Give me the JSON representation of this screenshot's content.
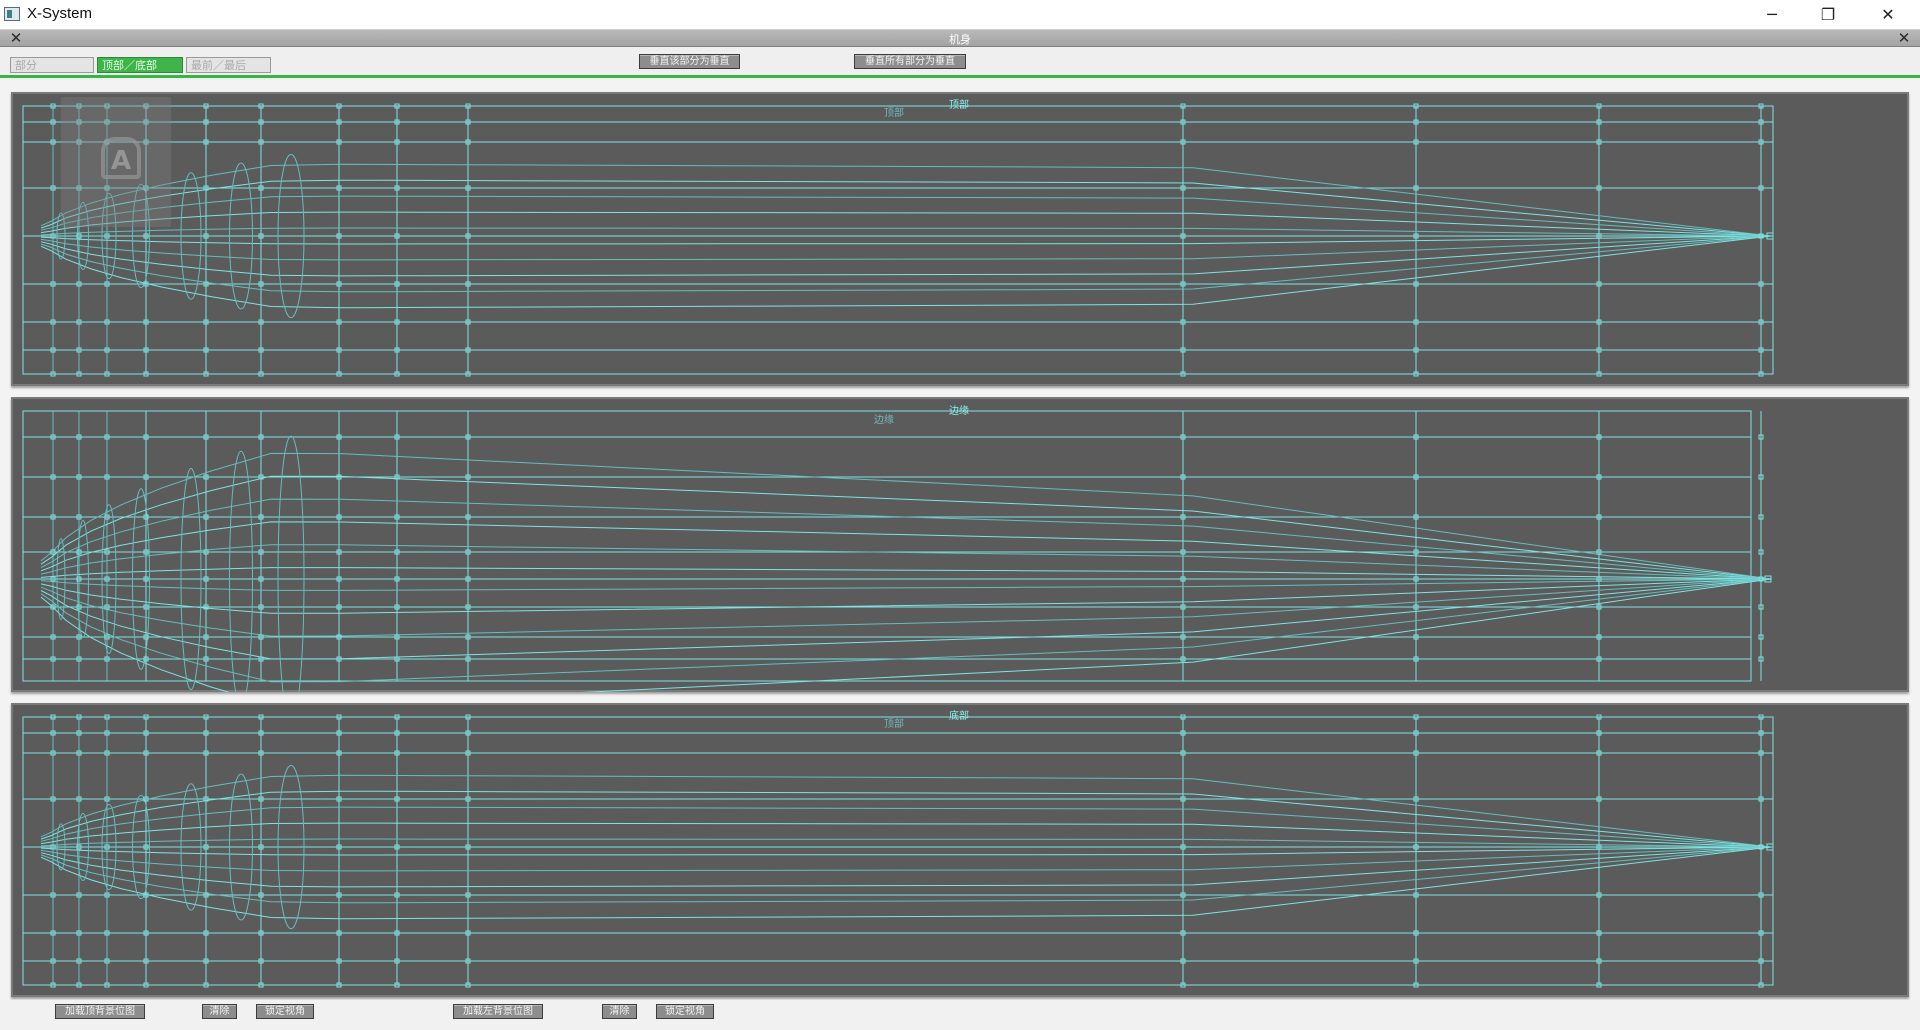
{
  "window": {
    "title": "X-System",
    "minimize_glyph": "─",
    "restore_glyph": "❐",
    "close_glyph": "✕"
  },
  "panel": {
    "title": "机身",
    "close_glyph": "✕"
  },
  "tabs": [
    {
      "label": "部分",
      "active": false
    },
    {
      "label": "顶部／底部",
      "active": true
    },
    {
      "label": "最前／最后",
      "active": false
    }
  ],
  "toolbar": {
    "reset_part_vertical": "垂直该部分为垂直",
    "reset_all_vertical": "垂直所有部分为垂直"
  },
  "viewports": {
    "top": {
      "label": "顶部",
      "sub_label": "顶部"
    },
    "side": {
      "label": "边缘",
      "sub_label": "边缘"
    },
    "bottom": {
      "label": "底部",
      "sub_label": "顶部"
    }
  },
  "bottom_buttons": {
    "load_top_bg": "加载顶背景位图",
    "clear_1": "清除",
    "lock_view_1": "锁定视角",
    "load_left_bg": "加载左背景位图",
    "clear_2": "清除",
    "lock_view_2": "锁定视角"
  },
  "colors": {
    "wire": "#7fe3e1",
    "wire_dim": "#68bcbc",
    "viewport_bg": "#5b5b5b",
    "active_tab": "#3fb44b"
  }
}
